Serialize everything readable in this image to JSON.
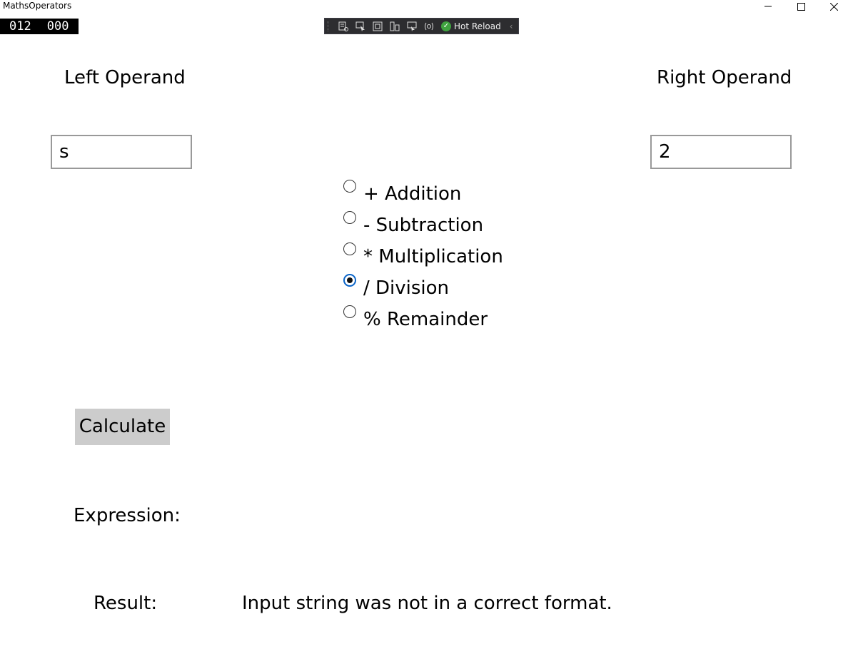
{
  "window": {
    "title": "MathsOperators"
  },
  "frame_counter": {
    "left": "012",
    "right": "000"
  },
  "debug_toolbar": {
    "hot_reload_label": "Hot Reload"
  },
  "left_operand": {
    "label": "Left Operand",
    "value": "s"
  },
  "right_operand": {
    "label": "Right Operand",
    "value": "2"
  },
  "operators": [
    {
      "label": "+ Addition",
      "checked": false
    },
    {
      "label": "- Subtraction",
      "checked": false
    },
    {
      "label": "* Multiplication",
      "checked": false
    },
    {
      "label": "/ Division",
      "checked": true
    },
    {
      "label": "% Remainder",
      "checked": false
    }
  ],
  "calculate_button": {
    "label": "Calculate"
  },
  "expression": {
    "label": "Expression:",
    "value": ""
  },
  "result": {
    "label": "Result:",
    "value": "Input string was not in a correct format."
  },
  "colors": {
    "radio_checked": "#0a64c8",
    "button_bg": "#cccccc",
    "toolbar_bg": "#2d2d30"
  }
}
